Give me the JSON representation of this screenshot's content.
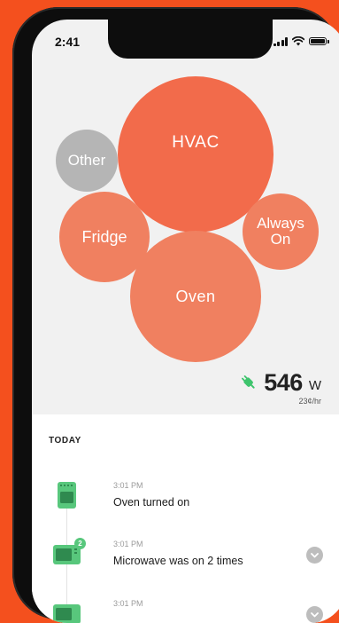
{
  "status_bar": {
    "time": "2:41"
  },
  "colors": {
    "background": "#f4501e",
    "bubble_primary": "#f26b4b",
    "bubble_secondary": "#f08060",
    "bubble_other": "#b5b5b5",
    "device_green": "#58c77c"
  },
  "bubbles": [
    {
      "label": "HVAC"
    },
    {
      "label": "Other"
    },
    {
      "label": "Fridge"
    },
    {
      "label": "Always On"
    },
    {
      "label": "Oven"
    }
  ],
  "power": {
    "value": "546",
    "unit": "W",
    "rate": "23¢/hr",
    "icon": "plug-icon"
  },
  "feed": {
    "section_title": "TODAY",
    "events": [
      {
        "time": "3:01 PM",
        "text": "Oven turned on",
        "icon": "oven-icon"
      },
      {
        "time": "3:01 PM",
        "text": "Microwave was on 2 times",
        "icon": "microwave-icon",
        "badge": "2"
      },
      {
        "time": "3:01 PM",
        "text": "",
        "icon": "microwave-icon"
      }
    ]
  }
}
